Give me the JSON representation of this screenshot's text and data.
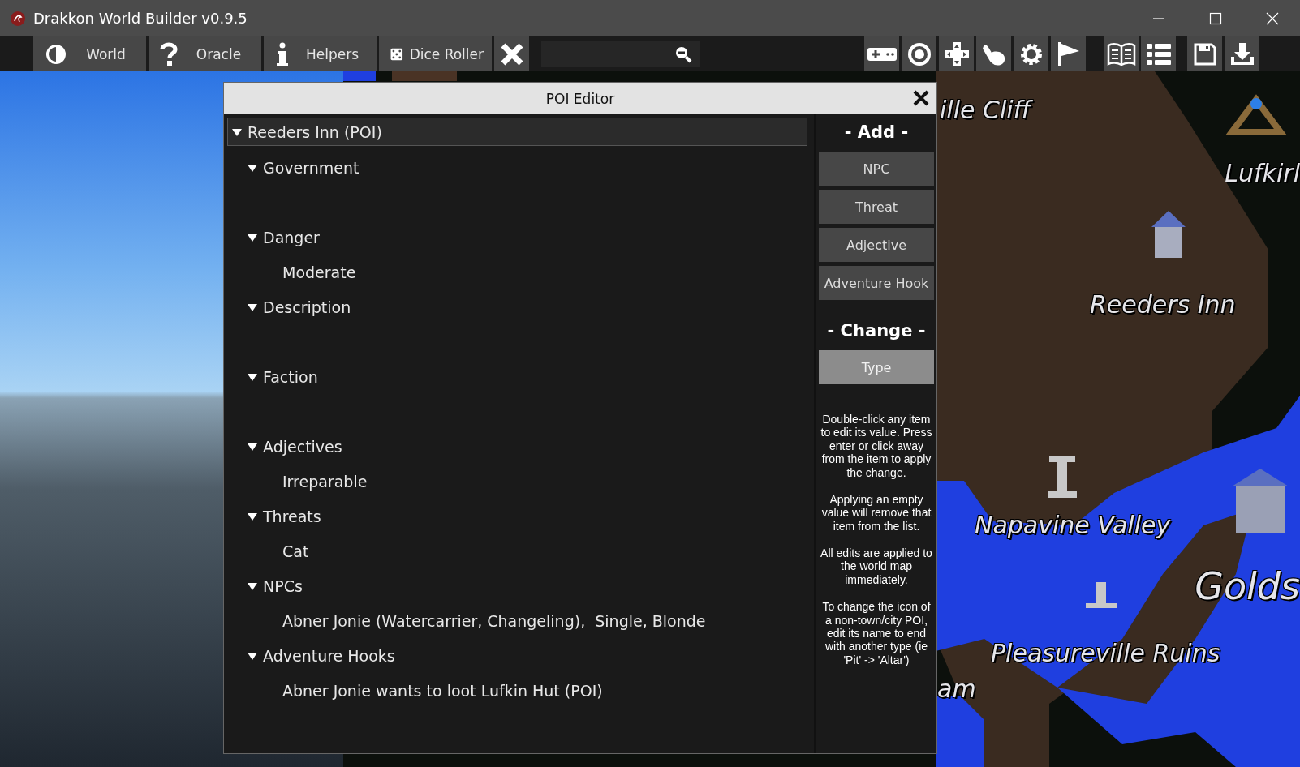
{
  "window": {
    "title": "Drakkon World Builder v0.9.5"
  },
  "toolbar": {
    "buttons": [
      {
        "label": "World"
      },
      {
        "label": "Oracle"
      },
      {
        "label": "Helpers"
      },
      {
        "label": "Dice Roller"
      }
    ]
  },
  "map_labels": [
    {
      "text": "ille Cliff",
      "kind": "place"
    },
    {
      "text": "Lufkirl",
      "kind": "place"
    },
    {
      "text": "Reeders Inn",
      "kind": "place"
    },
    {
      "text": "Napavine Valley",
      "kind": "place"
    },
    {
      "text": "Golds",
      "kind": "city"
    },
    {
      "text": "Pleasureville Ruins",
      "kind": "place"
    },
    {
      "text": "am",
      "kind": "place"
    }
  ],
  "dialog": {
    "title": "POI Editor",
    "tree": {
      "label": "Reeders Inn (POI)",
      "expanded": true,
      "children": [
        {
          "label": "Government",
          "expanded": true
        },
        {
          "label": "Danger",
          "expanded": true,
          "children": [
            {
              "label": "Moderate"
            }
          ]
        },
        {
          "label": "Description",
          "expanded": true
        },
        {
          "label": "Faction",
          "expanded": true
        },
        {
          "label": "Adjectives",
          "expanded": true,
          "children": [
            {
              "label": "Irreparable"
            }
          ]
        },
        {
          "label": "Threats",
          "expanded": true,
          "children": [
            {
              "label": "Cat"
            }
          ]
        },
        {
          "label": "NPCs",
          "expanded": true,
          "children": [
            {
              "label": "Abner Jonie (Watercarrier, Changeling),  Single, Blonde"
            }
          ]
        },
        {
          "label": "Adventure Hooks",
          "expanded": true,
          "children": [
            {
              "label": "Abner Jonie wants to loot Lufkin Hut (POI)"
            }
          ]
        }
      ]
    },
    "add_heading": "- Add -",
    "add_buttons": [
      "NPC",
      "Threat",
      "Adjective",
      "Adventure Hook"
    ],
    "change_heading": "- Change -",
    "change_buttons": [
      "Type"
    ],
    "help": [
      "Double-click any item to edit its value. Press enter or click away from the item to apply the change.",
      "Applying an empty value will remove that item from the list.",
      "All edits are applied to the world map immediately.",
      "To change the icon of a non-town/city POI, edit its name to end with another type (ie 'Pit' -> 'Altar')"
    ]
  }
}
